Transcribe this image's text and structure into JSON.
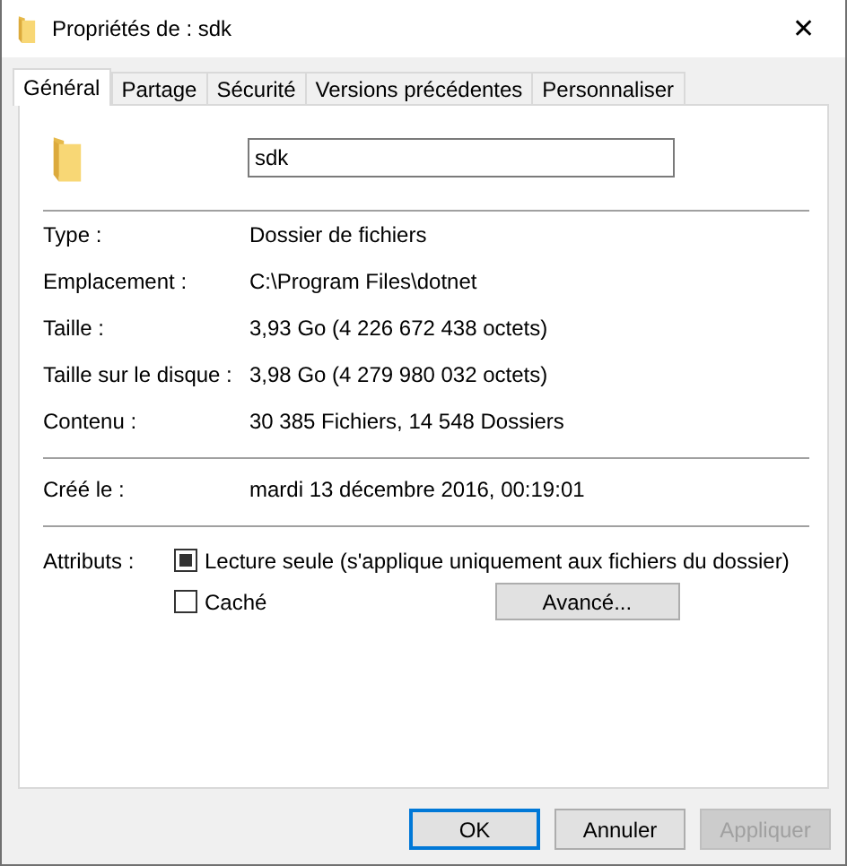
{
  "window": {
    "title": "Propriétés de : sdk",
    "close": "✕"
  },
  "tabs": [
    {
      "label": "Général",
      "selected": true
    },
    {
      "label": "Partage",
      "selected": false
    },
    {
      "label": "Sécurité",
      "selected": false
    },
    {
      "label": "Versions précédentes",
      "selected": false
    },
    {
      "label": "Personnaliser",
      "selected": false
    }
  ],
  "name_field": {
    "value": "sdk"
  },
  "properties": [
    {
      "label": "Type :",
      "value": "Dossier de fichiers"
    },
    {
      "label": "Emplacement :",
      "value": "C:\\Program Files\\dotnet"
    },
    {
      "label": "Taille :",
      "value": "3,93 Go (4 226 672 438 octets)"
    },
    {
      "label": "Taille sur le disque :",
      "value": "3,98 Go (4 279 980 032 octets)"
    },
    {
      "label": "Contenu :",
      "value": "30 385 Fichiers, 14 548 Dossiers"
    }
  ],
  "dates": [
    {
      "label": "Créé le :",
      "value": "mardi 13 décembre 2016, 00:19:01"
    }
  ],
  "attributes": {
    "label": "Attributs :",
    "advanced_button": "Avancé...",
    "items": [
      {
        "label": "Lecture seule (s'applique uniquement aux fichiers du dossier)",
        "checked": false,
        "indeterminate": true
      },
      {
        "label": "Caché",
        "checked": false,
        "indeterminate": false
      }
    ]
  },
  "buttons": [
    {
      "label": "OK",
      "kind": "default",
      "disabled": false
    },
    {
      "label": "Annuler",
      "kind": "normal",
      "disabled": false
    },
    {
      "label": "Appliquer",
      "kind": "normal",
      "disabled": true
    }
  ]
}
